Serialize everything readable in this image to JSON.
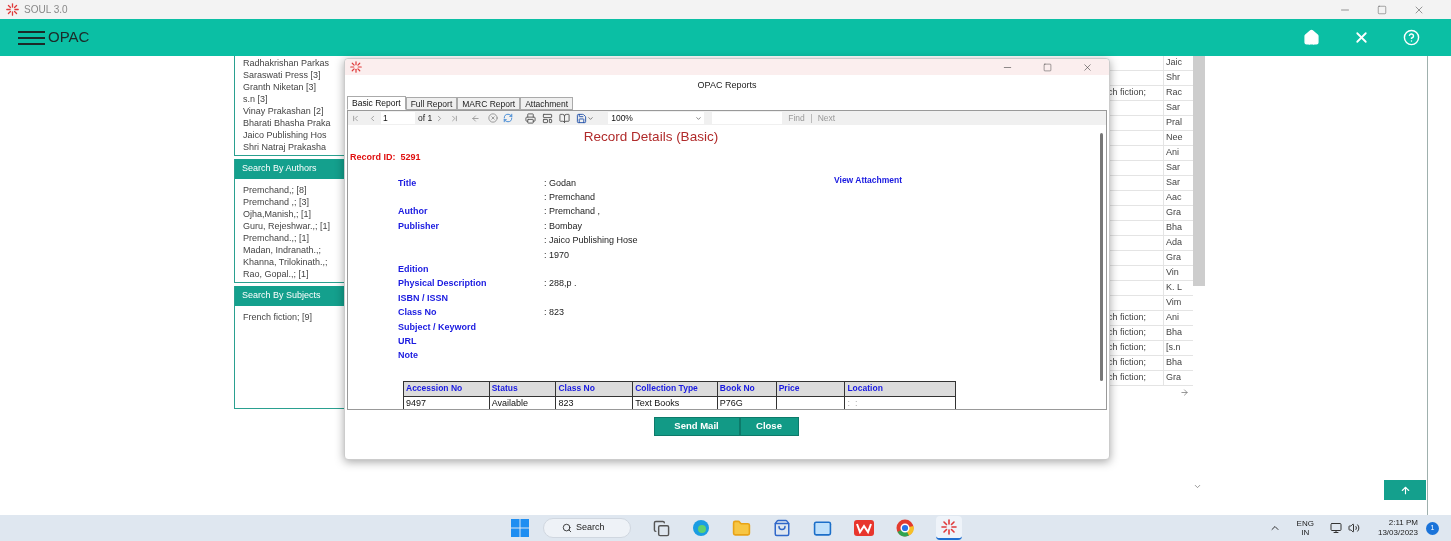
{
  "window": {
    "title": "SOUL 3.0"
  },
  "app_bar": {
    "title": "OPAC"
  },
  "facets": [
    {
      "items": [
        "Radhakrishan Parkas",
        "Saraswati Press [3]",
        "Granth Niketan [3]",
        "s.n [3]",
        "Vinay Prakashan [2]",
        "Bharati Bhasha Praka",
        "Jaico Publishing Hos",
        "Shri Natraj Prakasha"
      ]
    },
    {
      "heading": "Search By Authors",
      "items": [
        "Premchand,; [8]",
        "Premchand ,; [3]",
        "Ojha,Manish,; [1]",
        "Guru, Rejeshwar.,; [1]",
        "Premchand.,; [1]",
        "Madan, Indranath.,;",
        "Khanna, Trilokinath.,;",
        "Rao, Gopal.,; [1]"
      ]
    },
    {
      "heading": "Search By Subjects",
      "items": [
        "French fiction; [9]"
      ]
    }
  ],
  "results_table": {
    "rows": [
      {
        "publisher": "Jaic"
      },
      {
        "publisher": "Shr"
      },
      {
        "subject": "ch fiction;",
        "publisher": "Rac"
      },
      {
        "publisher": "Sar"
      },
      {
        "publisher": "Pral"
      },
      {
        "publisher": "Nee"
      },
      {
        "publisher": "Ani"
      },
      {
        "publisher": "Sar"
      },
      {
        "publisher": "Sar"
      },
      {
        "publisher": "Aac"
      },
      {
        "publisher": "Gra"
      },
      {
        "publisher": "Bha"
      },
      {
        "publisher": "Ada"
      },
      {
        "publisher": "Gra"
      },
      {
        "publisher": "Vin"
      },
      {
        "publisher": "K. L"
      },
      {
        "publisher": "Vim"
      },
      {
        "subject": "ch fiction;",
        "publisher": "Ani"
      },
      {
        "subject": "ch fiction;",
        "publisher": "Bha"
      },
      {
        "subject": "ch fiction;",
        "publisher": "[s.n"
      },
      {
        "subject": "ch fiction;",
        "publisher": "Bha"
      },
      {
        "subject": "ch fiction;",
        "publisher": "Gra"
      }
    ]
  },
  "dialog": {
    "title": "OPAC Reports",
    "tabs": [
      {
        "label": "Basic Report",
        "selected": true
      },
      {
        "label": "Full Report",
        "selected": false
      },
      {
        "label": "MARC Report",
        "selected": false
      },
      {
        "label": "Attachment",
        "selected": false
      }
    ],
    "toolbar": {
      "page": "1",
      "page_of": "of 1",
      "zoom": "100%",
      "find": "Find",
      "next": "Next"
    },
    "report": {
      "heading": "Record Details (Basic)",
      "record_id": "Record ID:  5291",
      "view_attachment": "View Attachment",
      "fields": [
        {
          "label": "Title",
          "value": ": Godan"
        },
        {
          "value": ": Premchand"
        },
        {
          "label": "Author",
          "value": ": Premchand ,"
        },
        {
          "label": "Publisher",
          "value": ": Bombay"
        },
        {
          "value": ": Jaico Publishing Hose"
        },
        {
          "value": ": 1970"
        },
        {
          "label": "Edition"
        },
        {
          "label": "Physical Description",
          "value": ": 288,p ."
        },
        {
          "label": "ISBN / ISSN"
        },
        {
          "label": "Class No",
          "value": ": 823"
        },
        {
          "label": "Subject / Keyword"
        },
        {
          "label": "URL"
        },
        {
          "label": "Note"
        }
      ],
      "holdings": {
        "columns": [
          "Accession No",
          "Status",
          "Class No",
          "Collection Type",
          "Book No",
          "Price",
          "Location"
        ],
        "rows": [
          [
            "9497",
            "Available",
            "823",
            "Text Books",
            "P76G",
            null,
            ":  :"
          ]
        ]
      }
    },
    "buttons": [
      "Send Mail",
      "Close"
    ]
  },
  "taskbar": {
    "search": "Search",
    "language": "ENG",
    "region": "IN",
    "time": "2:11 PM",
    "date": "13/03/2023",
    "notifications": "1"
  }
}
